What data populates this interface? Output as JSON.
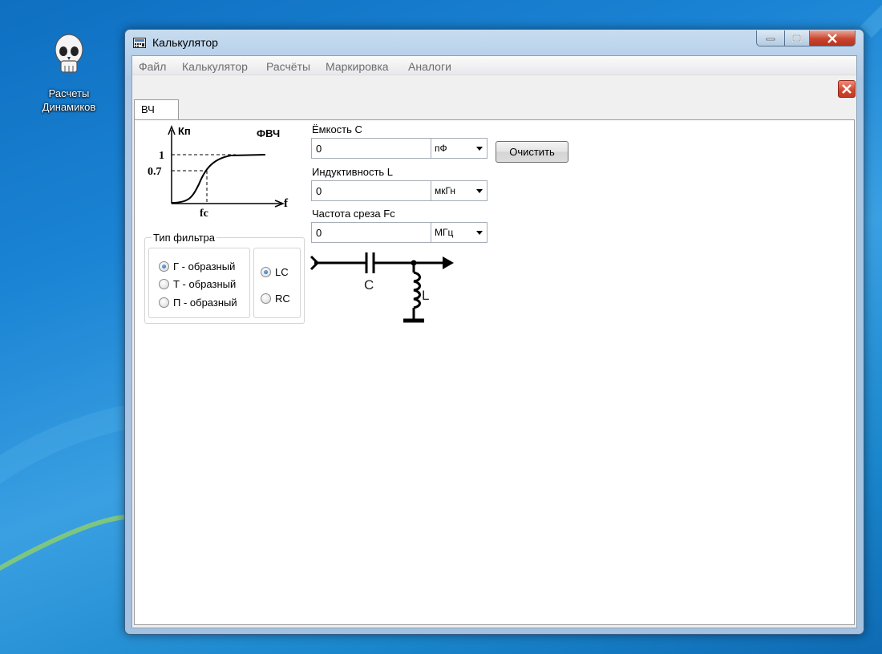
{
  "desktop": {
    "icon_label": "Расчеты Динамиков"
  },
  "window": {
    "title": "Калькулятор"
  },
  "menu": [
    "Файл",
    "Калькулятор",
    "Расчёты",
    "Маркировка",
    "Аналоги"
  ],
  "tab": {
    "label": "ВЧ"
  },
  "graph": {
    "y_axis": "Кп",
    "x_axis": "f",
    "title": "ФВЧ",
    "tick_1": "1",
    "tick_07": "0.7",
    "cutoff": "fc"
  },
  "fields": {
    "capacitance": {
      "label": "Ёмкость С",
      "value": "0",
      "unit": "пФ"
    },
    "inductance": {
      "label": "Индуктивность L",
      "value": "0",
      "unit": "мкГн"
    },
    "frequency": {
      "label": "Частота среза Fc",
      "value": "0",
      "unit": "МГц"
    }
  },
  "clear_button": "Очистить",
  "filter_type": {
    "title": "Тип фильтра",
    "options": [
      "Г - образный",
      "Т - образный",
      "П - образный"
    ],
    "selected": 0
  },
  "filter_kind": {
    "options": [
      "LC",
      "RC"
    ],
    "selected": 0
  },
  "schematic": {
    "cap_label": "C",
    "ind_label": "L"
  },
  "colors": {
    "desktop_blue": "#1b84d4",
    "title_close_red": "#c8452e",
    "radio_selected": "#1c5fa8"
  }
}
